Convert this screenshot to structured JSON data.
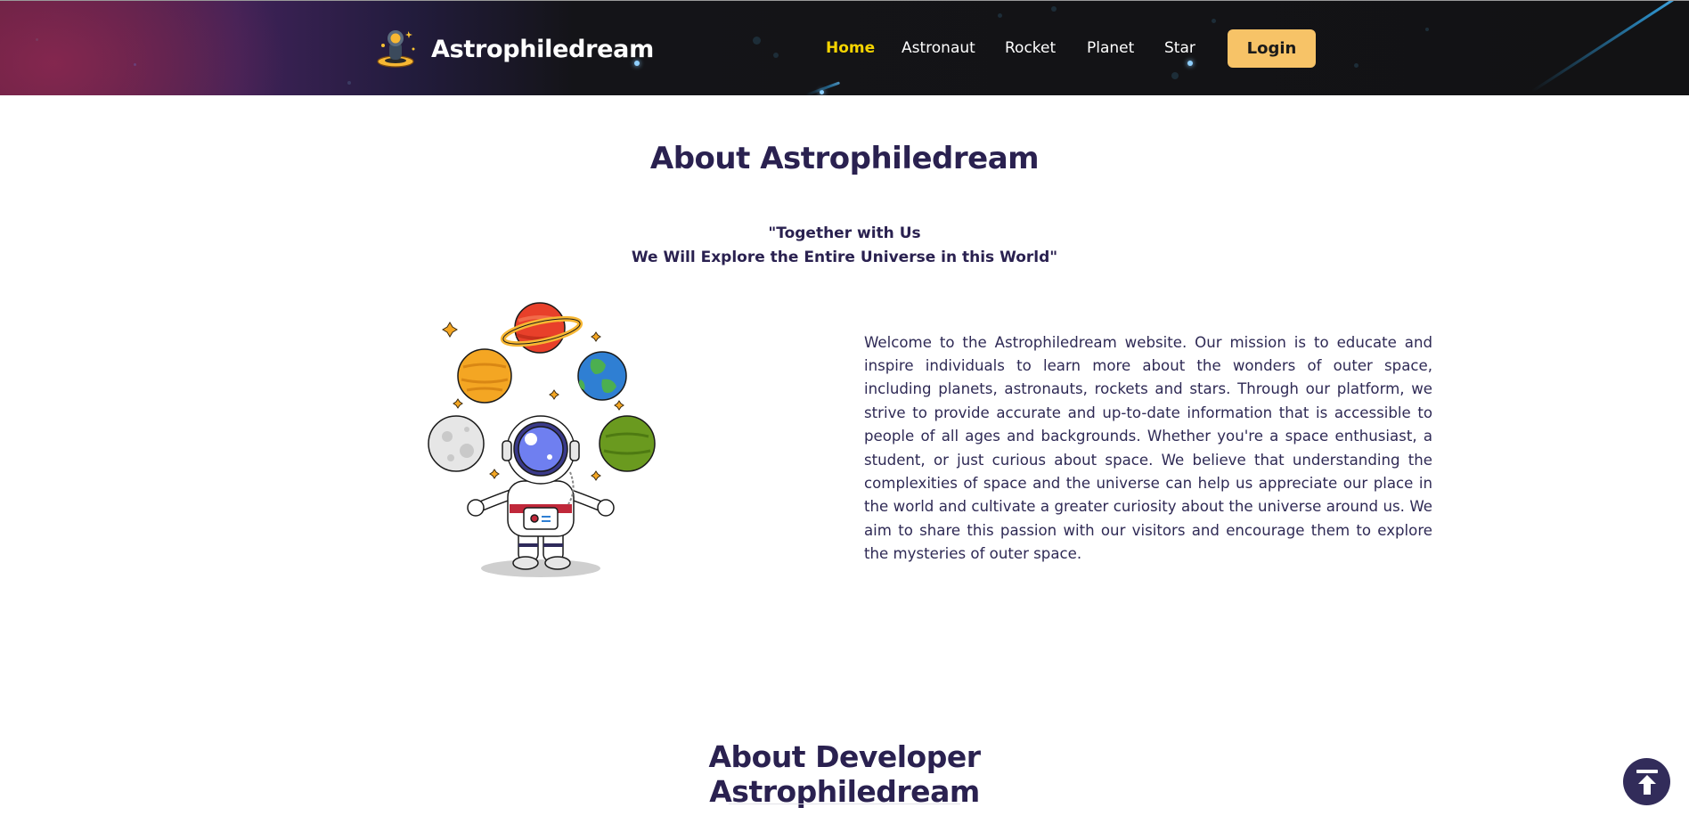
{
  "header": {
    "brand_name": "Astrophiledream",
    "brand_icon": "astronaut-on-planet-logo",
    "nav": [
      {
        "label": "Home",
        "active": true
      },
      {
        "label": "Astronaut",
        "active": false
      },
      {
        "label": "Rocket",
        "active": false
      },
      {
        "label": "Planet",
        "active": false
      },
      {
        "label": "Star",
        "active": false
      }
    ],
    "login_label": "Login"
  },
  "about": {
    "title": "About Astrophiledream",
    "quote_line1": "\"Together with Us",
    "quote_line2": "We Will Explore the Entire Universe in this World\"",
    "illustration": "astronaut-juggling-planets",
    "description": "Welcome to the Astrophiledream website. Our mission is to educate and inspire individuals to learn more about the wonders of outer space, including planets, astronauts, rockets and stars. Through our platform, we strive to provide accurate and up-to-date information that is accessible to people of all ages and backgrounds. Whether you're a space enthusiast, a student, or just curious about space. We believe that understanding the complexities of space and the universe can help us appreciate our place in the world and cultivate a greater curiosity about the universe around us. We aim to share this passion with our visitors and encourage them to explore the mysteries of outer space."
  },
  "developer": {
    "title_line1": "About Developer",
    "title_line2": "Astrophiledream"
  },
  "scroll_top_icon": "arrow-up-to-top-icon",
  "colors": {
    "accent_yellow": "#f5d400",
    "login_bg": "#f7c367",
    "heading": "#2a2150",
    "scroll_button": "#322c5a"
  }
}
